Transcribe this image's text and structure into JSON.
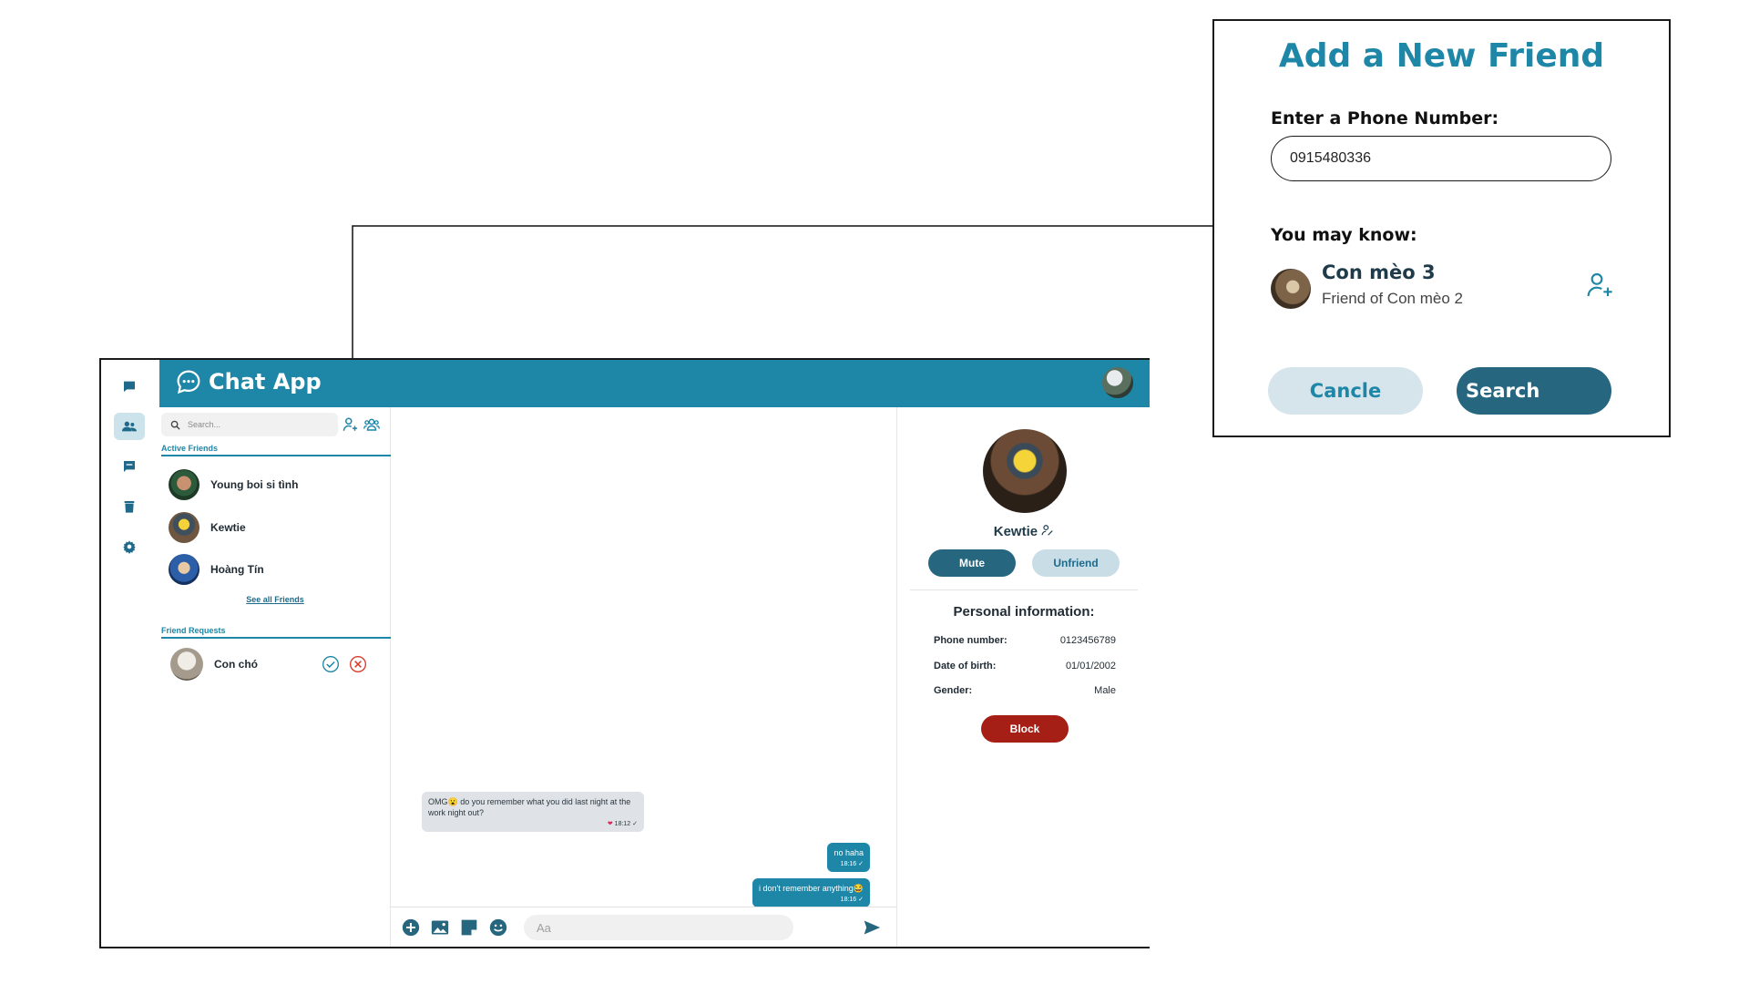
{
  "app": {
    "title": "Chat App",
    "rail": [
      "chat-icon",
      "contacts-icon",
      "messages-icon",
      "trash-icon",
      "settings-icon"
    ],
    "search_placeholder": "Search...",
    "active_friends_title": "Active Friends",
    "active_friends": [
      {
        "name": "Young boi si tình",
        "avatar": "dark-curly-hair"
      },
      {
        "name": "Kewtie",
        "avatar": "minion"
      },
      {
        "name": "Hoàng Tín",
        "avatar": "cartoon-boy"
      }
    ],
    "see_all": "See all Friends",
    "friend_requests_title": "Friend Requests",
    "friend_requests": [
      {
        "name": "Con chó"
      }
    ],
    "messages": [
      {
        "dir": "in",
        "text": "OMG😮 do you remember what you did last night at the work night out?",
        "time": "18:12 ✓",
        "reaction": "❤"
      },
      {
        "dir": "out",
        "text": "no haha",
        "time": "18:16 ✓"
      },
      {
        "dir": "out",
        "text": "i don't remember anything😂",
        "time": "18:16 ✓"
      }
    ],
    "composer_placeholder": "Aa"
  },
  "profile": {
    "name": "Kewtie",
    "mute": "Mute",
    "unfriend": "Unfriend",
    "info_title": "Personal information:",
    "phone_label": "Phone number:",
    "phone_value": "0123456789",
    "dob_label": "Date of birth:",
    "dob_value": "01/01/2002",
    "gender_label": "Gender:",
    "gender_value": "Male",
    "block": "Block"
  },
  "dialog": {
    "title": "Add a New Friend",
    "phone_label": "Enter a Phone Number:",
    "phone_value": "0915480336",
    "may_know_label": "You may know:",
    "suggestion_name": "Con mèo 3",
    "suggestion_sub": "Friend of Con mèo 2",
    "cancel": "Cancle",
    "search": "Search"
  },
  "colors": {
    "brand": "#1e86a7",
    "dark_teal": "#26677f",
    "block_red": "#a51f16"
  }
}
